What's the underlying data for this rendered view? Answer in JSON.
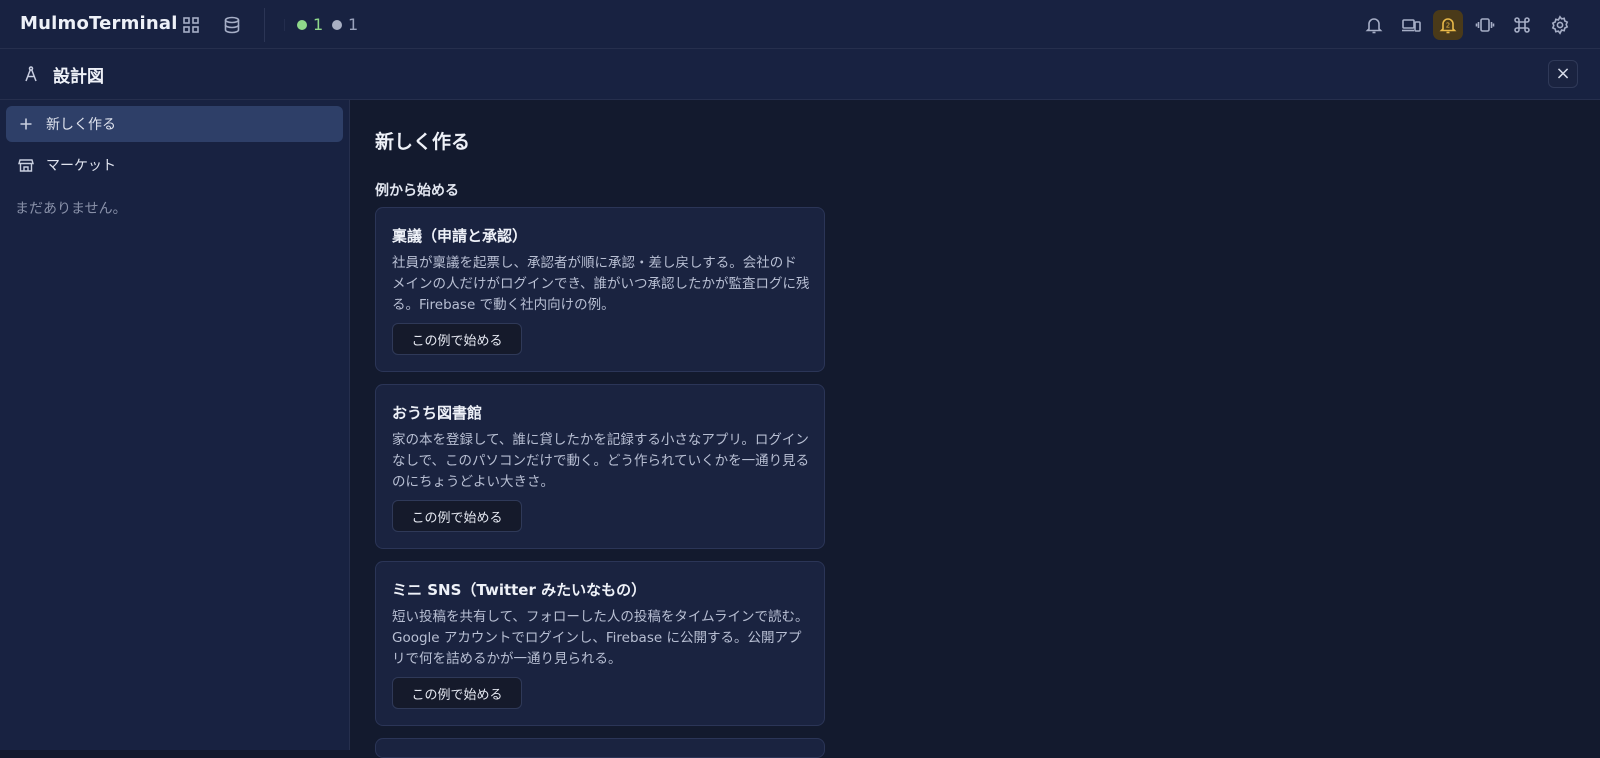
{
  "app": {
    "title": "MulmoTerminal"
  },
  "topbar": {
    "left_icons": [
      "grid-icon",
      "database-icon"
    ],
    "status": [
      {
        "count": "1",
        "color": "#8fd88a"
      },
      {
        "count": "1",
        "color": "#a9b0c3"
      }
    ],
    "right_icons": [
      "bell-icon",
      "devices-icon",
      "bell-badge-icon",
      "vibrate-icon",
      "command-icon",
      "settings-icon"
    ],
    "active_bell_badge": "2",
    "accent_color": "#e9b949"
  },
  "page": {
    "title": "設計図",
    "icon": "compass-icon",
    "close_label": "×"
  },
  "sidebar": {
    "items": [
      {
        "label": "新しく作る",
        "icon": "plus-icon",
        "active": true
      },
      {
        "label": "マーケット",
        "icon": "store-icon",
        "active": false
      }
    ],
    "empty_text": "まだありません。"
  },
  "main": {
    "title": "新しく作る",
    "section_title": "例から始める",
    "cards": [
      {
        "title": "稟議（申請と承認）",
        "description": "社員が稟議を起票し、承認者が順に承認・差し戻しする。会社のドメインの人だけがログインでき、誰がいつ承認したかが監査ログに残る。Firebase で動く社内向けの例。",
        "button": "この例で始める"
      },
      {
        "title": "おうち図書館",
        "description": "家の本を登録して、誰に貸したかを記録する小さなアプリ。ログインなしで、このパソコンだけで動く。どう作られていくかを一通り見るのにちょうどよい大きさ。",
        "button": "この例で始める"
      },
      {
        "title": "ミニ SNS（Twitter みたいなもの）",
        "description": "短い投稿を共有して、フォローした人の投稿をタイムラインで読む。Google アカウントでログインし、Firebase に公開する。公開アプリで何を詰めるかが一通り見られる。",
        "button": "この例で始める"
      }
    ]
  }
}
